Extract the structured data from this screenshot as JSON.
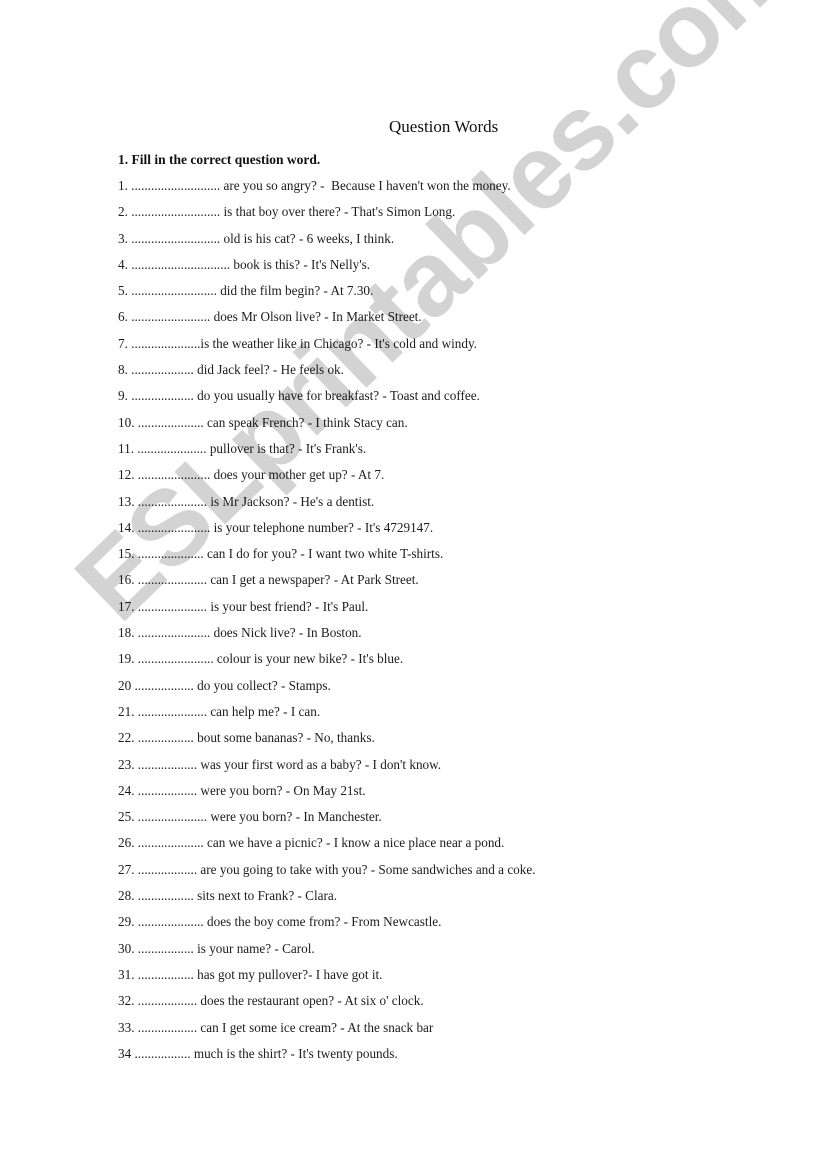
{
  "document": {
    "title": "Question Words",
    "instruction": "1. Fill in the correct question word.",
    "watermark": "ESLprintables.com",
    "items": [
      "1. ........................... are you so angry? -  Because I haven't won the money.",
      "2. ........................... is that boy over there? - That's Simon Long.",
      "3. ........................... old is his cat? - 6 weeks, I think.",
      "4. .............................. book is this? - It's Nelly's.",
      "5. .......................... did the film begin? - At 7.30.",
      "6. ........................ does Mr Olson live? - In Market Street.",
      "7. .....................is the weather like in Chicago? - It's cold and windy.",
      "8. ................... did Jack feel? - He feels ok.",
      "9. ................... do you usually have for breakfast? - Toast and coffee.",
      "10. .................... can speak French? - I think Stacy can.",
      "11. ..................... pullover is that? - It's Frank's.",
      "12. ...................... does your mother get up? - At 7.",
      "13. ..................... is Mr Jackson? - He's a dentist.",
      "14. ...................... is your telephone number? - It's 4729147.",
      "15. .................... can I do for you? - I want two white T-shirts.",
      "16. ..................... can I get a newspaper? - At Park Street.",
      "17. ..................... is your best friend? - It's Paul.",
      "18. ...................... does Nick live? - In Boston.",
      "19. ....................... colour is your new bike? - It's blue.",
      "20 .................. do you collect? - Stamps.",
      "21. ..................... can help me? - I can.",
      "22. ................. bout some bananas? - No, thanks.",
      "23. .................. was your first word as a baby? - I don't know.",
      "24. .................. were you born? - On May 21st.",
      "25. ..................... were you born? - In Manchester.",
      "26. .................... can we have a picnic? - I know a nice place near a pond.",
      "27. .................. are you going to take with you? - Some sandwiches and a coke.",
      "28. ................. sits next to Frank? - Clara.",
      "29. .................... does the boy come from? - From Newcastle.",
      "30. ................. is your name? - Carol.",
      "31. ................. has got my pullover?- I have got it.",
      "32. .................. does the restaurant open? - At six o' clock.",
      "33. .................. can I get some ice cream? - At the snack bar",
      "34 ................. much is the shirt? - It's twenty pounds."
    ]
  }
}
